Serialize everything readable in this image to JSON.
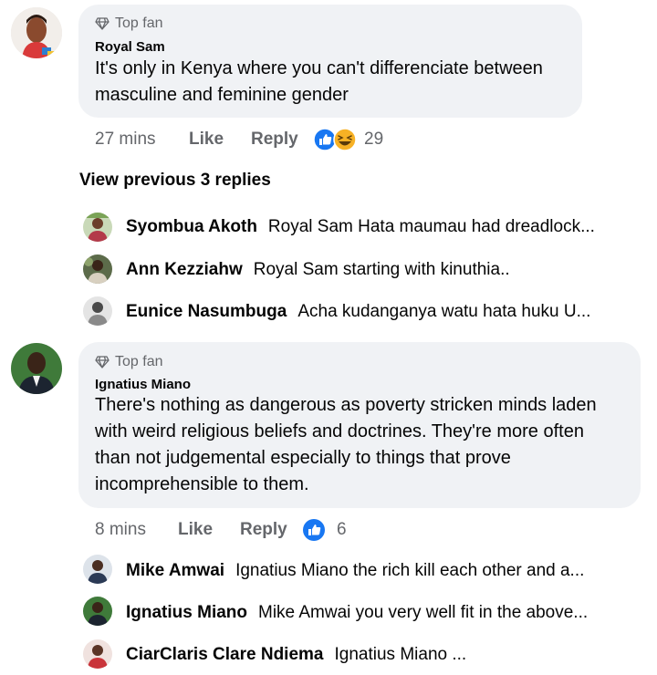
{
  "comments": [
    {
      "badge": "Top fan",
      "author": "Royal Sam",
      "text_lines": [
        "It's only in Kenya where you can't differenciate between",
        "masculine and feminine gender"
      ],
      "time": "27 mins",
      "like": "Like",
      "reply": "Reply",
      "reaction_count": "29",
      "view_previous": "View previous 3 replies",
      "replies": [
        {
          "name": "Syombua Akoth",
          "text": "Royal Sam Hata maumau had dreadlock..."
        },
        {
          "name": "Ann Kezziahw",
          "text": "Royal Sam starting with kinuthia.."
        },
        {
          "name": "Eunice Nasumbuga",
          "text": "Acha kudanganya watu hata huku U..."
        }
      ]
    },
    {
      "badge": "Top fan",
      "author": "Ignatius Miano",
      "text_lines": [
        "There's nothing as dangerous as poverty stricken minds laden",
        "with weird religious beliefs and doctrines. They're more often",
        "than not judgemental especially to things that prove",
        "incomprehensible to them."
      ],
      "time": "8 mins",
      "like": "Like",
      "reply": "Reply",
      "reaction_count": "6",
      "replies": [
        {
          "name": "Mike Amwai",
          "text": "Ignatius Miano the rich kill each other and a..."
        },
        {
          "name": "Ignatius Miano",
          "text": "Mike Amwai you very well fit in the above..."
        },
        {
          "name": "CiarClaris Clare Ndiema",
          "text": "Ignatius Miano ..."
        }
      ]
    }
  ],
  "colors": {
    "bubble": "#f0f2f5",
    "meta": "#65676b",
    "like_blue": "#1877f2",
    "haha_yellow": "#f7b125"
  }
}
